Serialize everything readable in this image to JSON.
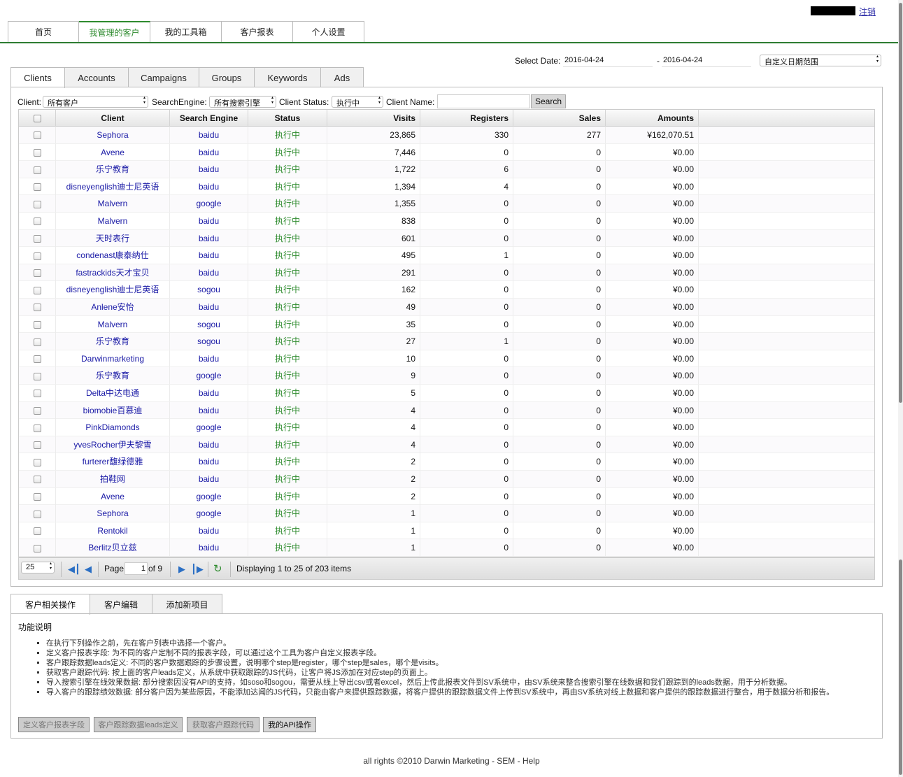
{
  "header": {
    "logout": "注销"
  },
  "topnav": [
    "首页",
    "我管理的客户",
    "我的工具箱",
    "客户报表",
    "个人设置"
  ],
  "date": {
    "label": "Select Date:",
    "from": "2016-04-24",
    "dash": "-",
    "to": "2016-04-24",
    "range_select": "自定义日期范围"
  },
  "tabs": [
    "Clients",
    "Accounts",
    "Campaigns",
    "Groups",
    "Keywords",
    "Ads"
  ],
  "filters": {
    "client_label": "Client:",
    "client_value": "所有客户",
    "engine_label": "SearchEngine:",
    "engine_value": "所有搜索引擎",
    "status_label": "Client Status:",
    "status_value": "执行中",
    "name_label": "Client Name:",
    "search_button": "Search"
  },
  "grid": {
    "columns": [
      "Client",
      "Search Engine",
      "Status",
      "Visits",
      "Registers",
      "Sales",
      "Amounts"
    ],
    "rows": [
      [
        "Sephora",
        "baidu",
        "执行中",
        "23,865",
        "330",
        "277",
        "¥162,070.51"
      ],
      [
        "Avene",
        "baidu",
        "执行中",
        "7,446",
        "0",
        "0",
        "¥0.00"
      ],
      [
        "乐宁教育",
        "baidu",
        "执行中",
        "1,722",
        "6",
        "0",
        "¥0.00"
      ],
      [
        "disneyenglish迪士尼英语",
        "baidu",
        "执行中",
        "1,394",
        "4",
        "0",
        "¥0.00"
      ],
      [
        "Malvern",
        "google",
        "执行中",
        "1,355",
        "0",
        "0",
        "¥0.00"
      ],
      [
        "Malvern",
        "baidu",
        "执行中",
        "838",
        "0",
        "0",
        "¥0.00"
      ],
      [
        "天时表行",
        "baidu",
        "执行中",
        "601",
        "0",
        "0",
        "¥0.00"
      ],
      [
        "condenast康泰纳仕",
        "baidu",
        "执行中",
        "495",
        "1",
        "0",
        "¥0.00"
      ],
      [
        "fastrackids天才宝贝",
        "baidu",
        "执行中",
        "291",
        "0",
        "0",
        "¥0.00"
      ],
      [
        "disneyenglish迪士尼英语",
        "sogou",
        "执行中",
        "162",
        "0",
        "0",
        "¥0.00"
      ],
      [
        "Anlene安怡",
        "baidu",
        "执行中",
        "49",
        "0",
        "0",
        "¥0.00"
      ],
      [
        "Malvern",
        "sogou",
        "执行中",
        "35",
        "0",
        "0",
        "¥0.00"
      ],
      [
        "乐宁教育",
        "sogou",
        "执行中",
        "27",
        "1",
        "0",
        "¥0.00"
      ],
      [
        "Darwinmarketing",
        "baidu",
        "执行中",
        "10",
        "0",
        "0",
        "¥0.00"
      ],
      [
        "乐宁教育",
        "google",
        "执行中",
        "9",
        "0",
        "0",
        "¥0.00"
      ],
      [
        "Delta中达电通",
        "baidu",
        "执行中",
        "5",
        "0",
        "0",
        "¥0.00"
      ],
      [
        "biomobie百慕迪",
        "baidu",
        "执行中",
        "4",
        "0",
        "0",
        "¥0.00"
      ],
      [
        "PinkDiamonds",
        "google",
        "执行中",
        "4",
        "0",
        "0",
        "¥0.00"
      ],
      [
        "yvesRocher伊夫黎雪",
        "baidu",
        "执行中",
        "4",
        "0",
        "0",
        "¥0.00"
      ],
      [
        "furterer馥绿德雅",
        "baidu",
        "执行中",
        "2",
        "0",
        "0",
        "¥0.00"
      ],
      [
        "拍鞋网",
        "baidu",
        "执行中",
        "2",
        "0",
        "0",
        "¥0.00"
      ],
      [
        "Avene",
        "google",
        "执行中",
        "2",
        "0",
        "0",
        "¥0.00"
      ],
      [
        "Sephora",
        "google",
        "执行中",
        "1",
        "0",
        "0",
        "¥0.00"
      ],
      [
        "Rentokil",
        "baidu",
        "执行中",
        "1",
        "0",
        "0",
        "¥0.00"
      ],
      [
        "Berlitz贝立兹",
        "baidu",
        "执行中",
        "1",
        "0",
        "0",
        "¥0.00"
      ]
    ]
  },
  "pager": {
    "page_size": "25",
    "page_label": "Page",
    "page_value": "1",
    "of_label": "of 9",
    "display": "Displaying 1 to 25 of 203 items"
  },
  "lower_tabs": [
    "客户相关操作",
    "客户编辑",
    "添加新项目"
  ],
  "help": {
    "title": "功能说明",
    "items": [
      "在执行下列操作之前，先在客户列表中选择一个客户。",
      "定义客户报表字段: 为不同的客户定制不同的报表字段，可以通过这个工具为客户自定义报表字段。",
      "客户跟踪数据leads定义: 不同的客户数据跟踪的步骤设置，说明哪个step是register，哪个step是sales，哪个是visits。",
      "获取客户跟踪代码: 按上面的客户leads定义，从系统中获取跟踪的JS代码，让客户将JS添加在对应step的页面上。",
      "导入搜索引擎在线效果数据: 部分搜索因没有API的支持，如soso和sogou，需要从线上导出csv或者excel，然后上传此报表文件到SV系统中，由SV系统来整合搜索引擎在线数据和我们跟踪到的leads数据，用于分析数据。",
      "导入客户的跟踪绩效数据: 部分客户因为某些原因，不能添加达闻的JS代码，只能由客户来提供跟踪数据，将客户提供的跟踪数据文件上传到SV系统中，再由SV系统对线上数据和客户提供的跟踪数据进行整合，用于数据分析和报告。"
    ]
  },
  "action_buttons": [
    "定义客户报表字段",
    "客户跟踪数据leads定义",
    "获取客户跟踪代码",
    "我的API操作"
  ],
  "footer": "all rights ©2010 Darwin Marketing - SEM - Help",
  "colors": {
    "accent": "#2e7d32",
    "link": "#1a1aa6",
    "status": "#2e8b2e"
  }
}
